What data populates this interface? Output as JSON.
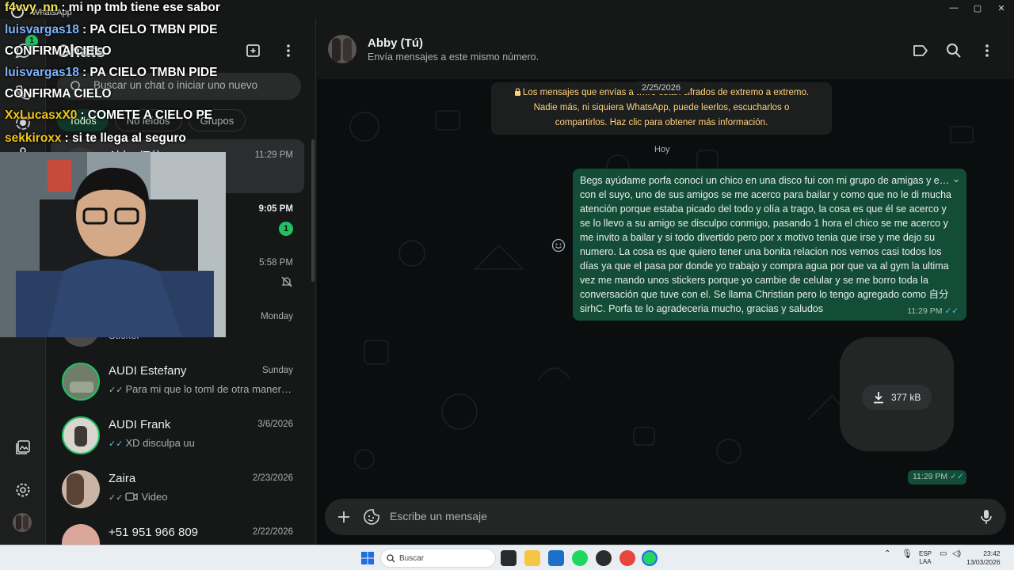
{
  "window": {
    "app_title": "WhatsApp",
    "minimize": "—",
    "maximize": "▢",
    "close": "✕"
  },
  "sidebar": {
    "title": "Chats",
    "unread_count": "1",
    "search_placeholder": "Buscar un chat o iniciar uno nuevo",
    "filters": [
      "Todos",
      "No leídos",
      "Grupos"
    ],
    "chats": [
      {
        "name": "Abby (Tú)",
        "time": "11:29 PM",
        "preview": "",
        "selected": true
      },
      {
        "name": "",
        "time": "9:05 PM",
        "preview": "",
        "unread": "1"
      },
      {
        "name": "",
        "time": "5:58 PM",
        "preview": "",
        "muted": true
      },
      {
        "name": "",
        "time": "Monday",
        "preview": "Sticker"
      },
      {
        "name": "AUDI Estefany",
        "time": "Sunday",
        "preview": "Para mi que lo toml de otra manera ...",
        "ticks": "✓✓",
        "tick_color": "grey"
      },
      {
        "name": "AUDI Frank",
        "time": "3/6/2026",
        "preview": "XD disculpa uu",
        "ticks": "✓✓",
        "tick_color": "blue"
      },
      {
        "name": "Zaira",
        "time": "2/23/2026",
        "preview": "Video",
        "ticks": "✓✓",
        "tick_color": "grey"
      },
      {
        "name": "+51 951 966 809",
        "time": "2/22/2026",
        "preview": ""
      }
    ]
  },
  "conversation": {
    "name": "Abby (Tú)",
    "status": "Envía mensajes a este mismo número.",
    "floating_date": "2/25/2026",
    "encryption_notice": "Los mensajes que envías a t…ro están cifrados de extremo a extremo. Nadie más, ni siquiera WhatsApp, puede leerlos, escucharlos o compartirlos. Haz clic para obtener más información.",
    "day_label": "Hoy",
    "message": {
      "text": "Begs ayúdame porfa conocí un chico en una disco fui con mi grupo de amigas y e… con el suyo, uno de sus amigos se me acerco para bailar y como que no le di mucha atención porque estaba picado del todo y olía a trago, la cosa es que él se acerco y se lo llevo a su amigo se disculpo conmigo, pasando 1 hora el chico se me acerco y me invito a bailar y si todo divertido pero por x motivo tenia que irse y me dejo su numero. La cosa es que quiero tener una bonita relacion nos vemos casi todos los días ya que el pasa por donde yo trabajo y compra agua por que va al gym la ultima vez me mando unos stickers porque yo cambie de celular y se me borro toda la conversación que tuve con el. Se llama Christian pero lo tengo agregado como 自分 sirhC. Porfa te lo agradeceria mucho, gracias y saludos",
      "time": "11:29 PM",
      "ticks": "✓✓"
    },
    "file": {
      "size": "377 kB",
      "time": "11:29 PM",
      "ticks": "✓✓"
    },
    "composer_placeholder": "Escribe un mensaje"
  },
  "stream_chat": [
    {
      "user": "f4vvy_nn",
      "color": "#f5e663",
      "message": ": mi np tmb tiene ese sabor"
    },
    {
      "user": "luisvargas18",
      "color": "#7fb3ff",
      "message": ": PA CIELO TMBN PIDE CONFIRMA CIELO"
    },
    {
      "user": "luisvargas18",
      "color": "#7fb3ff",
      "message": ": PA CIELO TMBN PIDE CONFIRMA CIELO"
    },
    {
      "user": "XxLucasxX0",
      "color": "#f0c419",
      "message": ": COMETE A CIELO PE"
    },
    {
      "user": "sekkiroxx",
      "color": "#f0c419",
      "message": ": si te llega al seguro"
    }
  ],
  "taskbar": {
    "search_label": "Buscar",
    "language": "ESP",
    "layout": "LAA",
    "time": "23:42",
    "date": "13/03/2026"
  },
  "colors": {
    "accent": "#21c063",
    "bubble_out": "#144d37",
    "read_ticks": "#53bdeb"
  }
}
